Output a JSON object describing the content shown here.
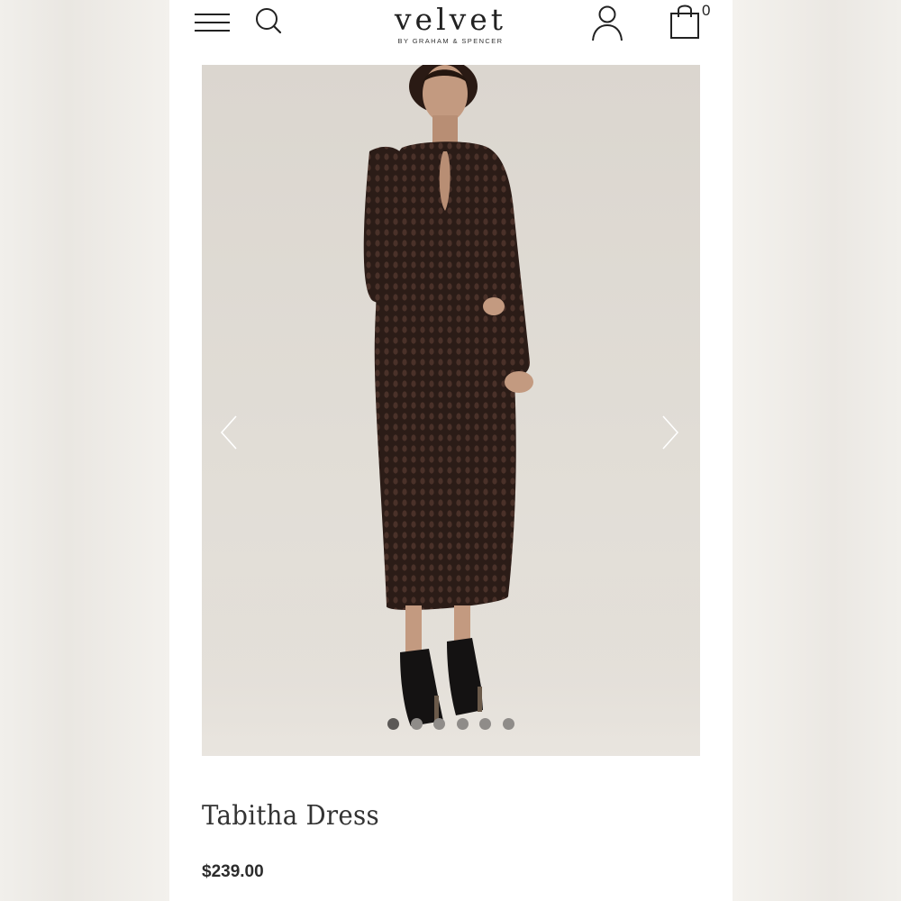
{
  "header": {
    "menu_icon": "hamburger-menu-icon",
    "search_icon": "search-icon",
    "brand_name": "velvet",
    "brand_sub": "BY GRAHAM & SPENCER",
    "account_icon": "user-icon",
    "cart_icon": "shopping-bag-icon",
    "cart_count": "0"
  },
  "gallery": {
    "image": "model wearing long-sleeve dark brown crochet midi dress with keyhole neckline and black ankle boots",
    "prev_icon": "chevron-left-icon",
    "next_icon": "chevron-right-icon",
    "slide_count": 6,
    "active_slide": 1
  },
  "product": {
    "title": "Tabitha Dress",
    "price": "$239.00"
  },
  "colors": {
    "page_bg": "#f4f2ee",
    "surface": "#ffffff",
    "photo_bg": "#ddd8d1",
    "dress": "#2b1c17",
    "text": "#2a2a2a"
  }
}
